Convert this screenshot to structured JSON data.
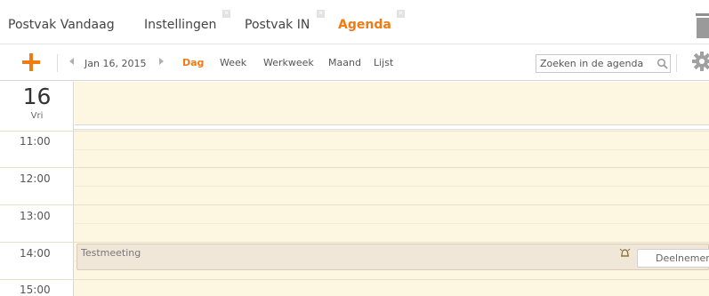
{
  "tabs": [
    {
      "label": "Postvak Vandaag"
    },
    {
      "label": "Instellingen"
    },
    {
      "label": "Postvak IN"
    },
    {
      "label": "Agenda"
    }
  ],
  "toolbar": {
    "date_label": "Jan 16, 2015",
    "views": [
      "Dag",
      "Week",
      "Werkweek",
      "Maand",
      "Lijst"
    ],
    "active_view": "Dag"
  },
  "search": {
    "placeholder": "Zoeken in de agenda"
  },
  "day": {
    "number": "16",
    "name": "Vri"
  },
  "hours": [
    "11:00",
    "12:00",
    "13:00",
    "14:00",
    "15:00"
  ],
  "event": {
    "title": "Testmeeting",
    "accept_label": "Deelnemen"
  },
  "colors": {
    "accent": "#f07b12",
    "grid_bg": "#fdf6e0",
    "event_bg": "#f1e7d9"
  }
}
